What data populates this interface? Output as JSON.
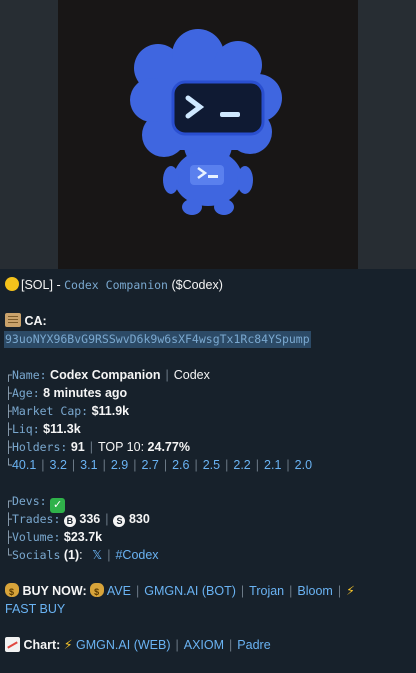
{
  "header": {
    "chain": "[SOL]",
    "dash": "-",
    "name": "Codex Companion",
    "ticker": "($Codex)"
  },
  "ca": {
    "label": "CA:",
    "address": "93uoNYX96BvG9RSSwvD6k9w6sXF4wsgTx1Rc84YSpump"
  },
  "stats": {
    "tree": [
      "┌",
      "├",
      "├",
      "├",
      "├",
      "└"
    ],
    "name_label": "Name:",
    "name_value": "Codex Companion",
    "name_alt": "Codex",
    "age_label": "Age:",
    "age_value": "8 minutes ago",
    "mcap_label": "Market Cap:",
    "mcap_value": "$11.9k",
    "liq_label": "Liq:",
    "liq_value": "$11.3k",
    "holders_label": "Holders:",
    "holders_value": "91",
    "top10_label": "TOP 10:",
    "top10_value": "24.77%",
    "holder_pcts": [
      "40.1",
      "3.2",
      "3.1",
      "2.9",
      "2.7",
      "2.6",
      "2.5",
      "2.2",
      "2.1",
      "2.0"
    ]
  },
  "dev": {
    "tree": [
      "┌",
      "├",
      "├",
      "└"
    ],
    "devs_label": "Devs:",
    "trades_label": "Trades:",
    "buys": "336",
    "sells": "830",
    "volume_label": "Volume:",
    "volume_value": "$23.7k",
    "socials_label": "Socials",
    "socials_count": "(1)",
    "socials_colon": ":",
    "x_link": "𝕏",
    "hashtag": "#Codex"
  },
  "buy": {
    "label": "BUY NOW:",
    "links": [
      "AVE",
      "GMGN.AI (BOT)",
      "Trojan",
      "Bloom"
    ],
    "fast_buy": "FAST BUY"
  },
  "chart_links": {
    "label": "Chart:",
    "links": [
      "GMGN.AI (WEB)",
      "AXIOM",
      "Padre"
    ]
  },
  "icons": {
    "coin": "yellow-circle-icon",
    "scroll": "scroll-icon",
    "check": "check-mark-icon",
    "bag": "money-bag-icon",
    "bolt": "lightning-icon",
    "chart": "chart-up-icon"
  }
}
